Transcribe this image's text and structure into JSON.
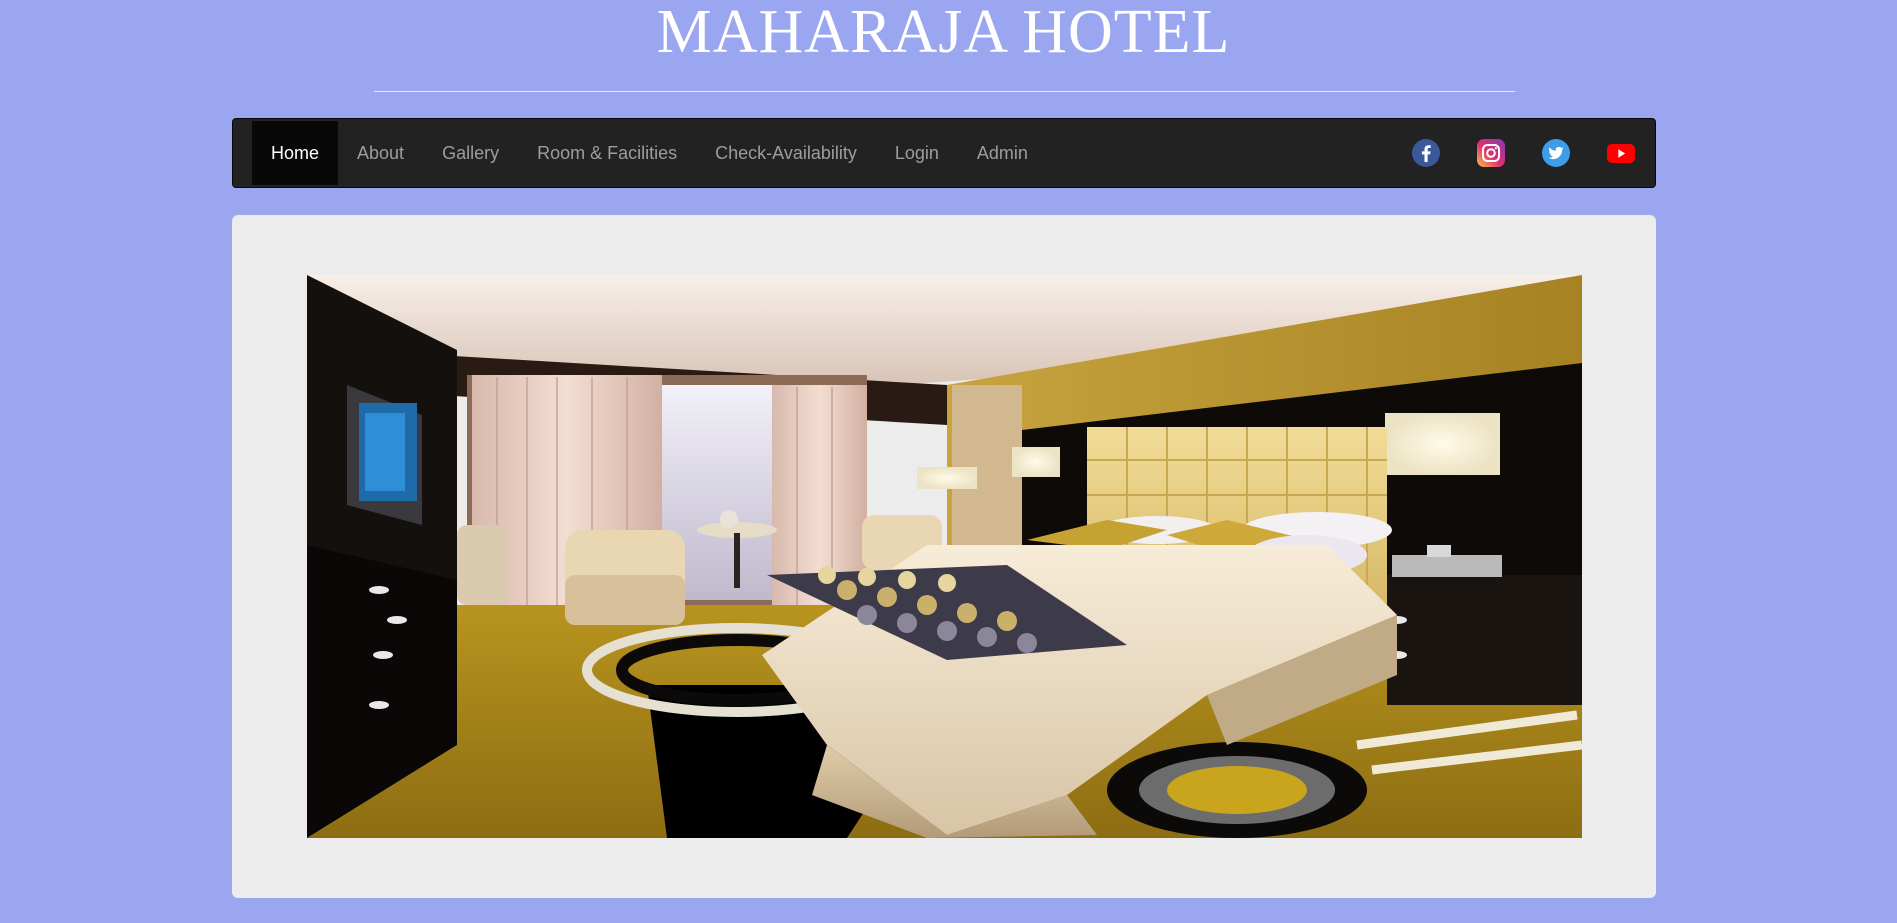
{
  "header": {
    "title": "MAHARAJA HOTEL"
  },
  "nav": {
    "items": [
      {
        "label": "Home",
        "active": true
      },
      {
        "label": "About"
      },
      {
        "label": "Gallery"
      },
      {
        "label": "Room & Facilities"
      },
      {
        "label": "Check-Availability"
      },
      {
        "label": "Login"
      },
      {
        "label": "Admin"
      }
    ],
    "social": [
      "facebook-icon",
      "instagram-icon",
      "twitter-icon",
      "youtube-icon"
    ]
  },
  "hero": {
    "image": "hotel-room-photo"
  },
  "colors": {
    "page_background": "#9ba6f0",
    "navbar_background": "#222222",
    "nav_active_background": "#080808",
    "nav_text": "#9d9d9d",
    "card_background": "#ececec"
  }
}
